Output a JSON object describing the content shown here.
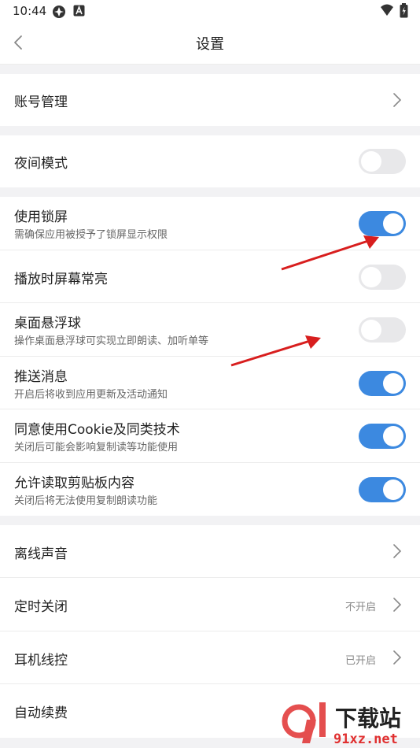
{
  "status": {
    "time": "10:44"
  },
  "header": {
    "title": "设置"
  },
  "rows": {
    "account": {
      "label": "账号管理"
    },
    "night": {
      "label": "夜间模式",
      "on": false
    },
    "lockscreen": {
      "label": "使用锁屏",
      "sub": "需确保应用被授予了锁屏显示权限",
      "on": true
    },
    "keepawake": {
      "label": "播放时屏幕常亮",
      "on": false
    },
    "floatball": {
      "label": "桌面悬浮球",
      "sub": "操作桌面悬浮球可实现立即朗读、加听单等",
      "on": false
    },
    "push": {
      "label": "推送消息",
      "sub": "开启后将收到应用更新及活动通知",
      "on": true
    },
    "cookie": {
      "label": "同意使用Cookie及同类技术",
      "sub": "关闭后可能会影响复制读等功能使用",
      "on": true
    },
    "clipboard": {
      "label": "允许读取剪贴板内容",
      "sub": "关闭后将无法使用复制朗读功能",
      "on": true
    },
    "offline": {
      "label": "离线声音"
    },
    "timer": {
      "label": "定时关闭",
      "value": "不开启"
    },
    "headset": {
      "label": "耳机线控",
      "value": "已开启"
    },
    "autorenew": {
      "label": "自动续费"
    }
  },
  "watermark": {
    "brand": "下载站",
    "domain": "91xz.net"
  },
  "colors": {
    "accent": "#3c89e0",
    "arrow": "#d81e1e"
  }
}
